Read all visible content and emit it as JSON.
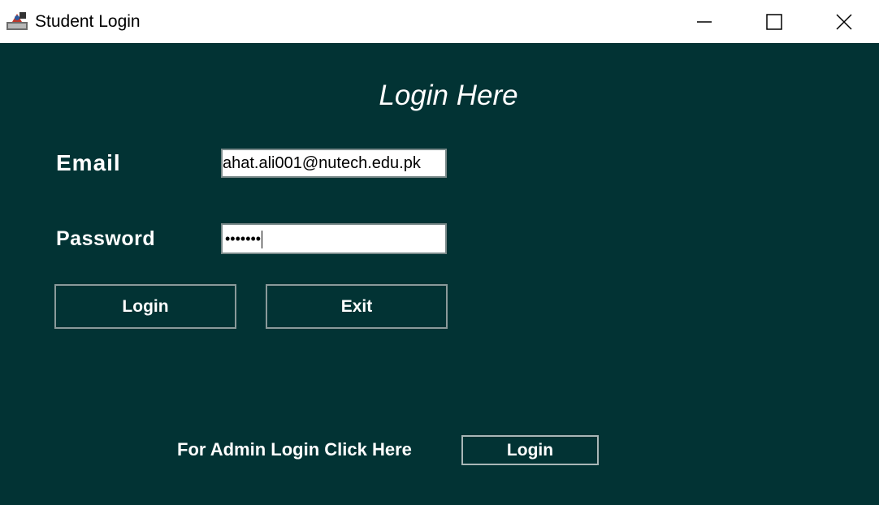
{
  "window": {
    "title": "Student Login",
    "icon": "java-app-icon"
  },
  "form": {
    "heading": "Login Here",
    "email_label": "Email",
    "email_value": "ahat.ali001@nutech.edu.pk",
    "password_label": "Password",
    "password_masked": "•••••••",
    "login_button": "Login",
    "exit_button": "Exit"
  },
  "admin": {
    "prompt": "For Admin Login Click Here",
    "login_button": "Login"
  },
  "colors": {
    "background": "#023334",
    "text": "#ffffff"
  }
}
